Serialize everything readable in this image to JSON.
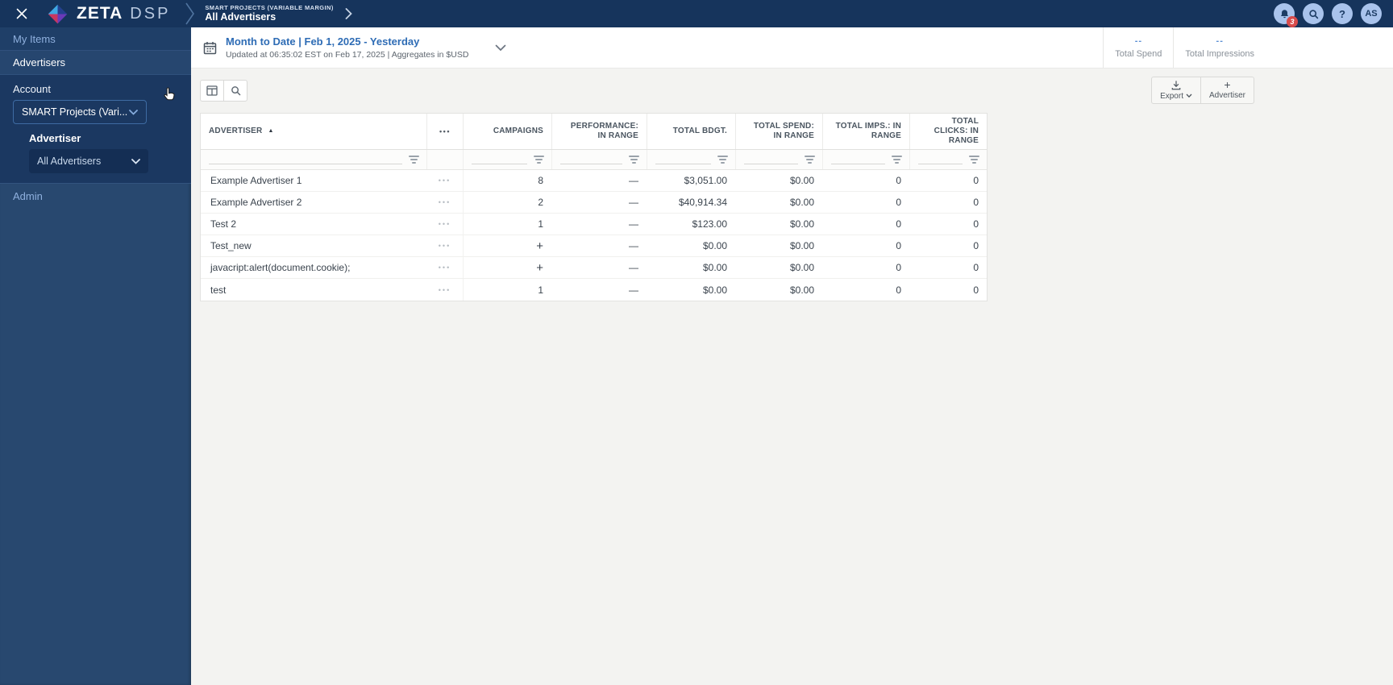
{
  "topbar": {
    "brand_primary": "ZETA",
    "brand_secondary": "DSP",
    "breadcrumb_account": "SMART PROJECTS (VARIABLE MARGIN)",
    "breadcrumb_page": "All Advertisers",
    "notification_badge": "3",
    "help_label": "?",
    "user_initials": "AS"
  },
  "sidebar": {
    "my_items_label": "My Items",
    "advertisers_label": "Advertisers",
    "account_label": "Account",
    "account_value": "SMART Projects (Vari...",
    "advertiser_label": "Advertiser",
    "advertiser_value": "All Advertisers",
    "admin_label": "Admin"
  },
  "date_header": {
    "title": "Month to Date | Feb 1, 2025 - Yesterday",
    "subtitle": "Updated at 06:35:02 EST on Feb 17, 2025 | Aggregates in $USD"
  },
  "summary_stats": [
    {
      "value": "--",
      "label": "Total Spend"
    },
    {
      "value": "--",
      "label": "Total Impressions"
    }
  ],
  "toolbar": {
    "export_label": "Export",
    "add_advertiser_label": "Advertiser"
  },
  "icons": {
    "sort_asc": "▲",
    "column_menu": "•••",
    "row_menu": "•••",
    "add_plus": "+"
  },
  "table": {
    "columns": {
      "advertiser": "ADVERTISER",
      "campaigns": "CAMPAIGNS",
      "performance": "PERFORMANCE: IN RANGE",
      "total_budget": "TOTAL BDGT.",
      "total_spend": "TOTAL SPEND: IN RANGE",
      "total_imps": "TOTAL IMPS.: IN RANGE",
      "total_clicks": "TOTAL CLICKS: IN RANGE"
    },
    "rows": [
      {
        "advertiser": "Example Advertiser 1",
        "campaigns": "8",
        "performance": "—",
        "total_budget": "$3,051.00",
        "total_spend": "$0.00",
        "total_imps": "0",
        "total_clicks": "0"
      },
      {
        "advertiser": "Example Advertiser 2",
        "campaigns": "2",
        "performance": "—",
        "total_budget": "$40,914.34",
        "total_spend": "$0.00",
        "total_imps": "0",
        "total_clicks": "0"
      },
      {
        "advertiser": "Test 2",
        "campaigns": "1",
        "performance": "—",
        "total_budget": "$123.00",
        "total_spend": "$0.00",
        "total_imps": "0",
        "total_clicks": "0"
      },
      {
        "advertiser": "Test_new",
        "campaigns": "+",
        "performance": "—",
        "total_budget": "$0.00",
        "total_spend": "$0.00",
        "total_imps": "0",
        "total_clicks": "0"
      },
      {
        "advertiser": "javacript:alert(document.cookie);",
        "campaigns": "+",
        "performance": "—",
        "total_budget": "$0.00",
        "total_spend": "$0.00",
        "total_imps": "0",
        "total_clicks": "0"
      },
      {
        "advertiser": "test",
        "campaigns": "1",
        "performance": "—",
        "total_budget": "$0.00",
        "total_spend": "$0.00",
        "total_imps": "0",
        "total_clicks": "0"
      }
    ]
  },
  "colors": {
    "topbar_bg": "#16345c",
    "sidebar_bg": "#28486f",
    "link_blue": "#2e6cb5",
    "badge_red": "#d84b4b",
    "stat_blue": "#5b8fd4"
  }
}
